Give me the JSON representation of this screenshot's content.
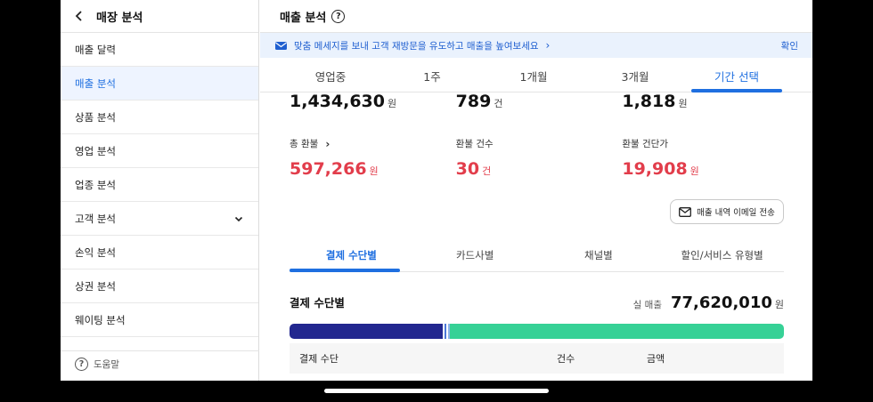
{
  "sidebar": {
    "title": "매장 분석",
    "items": [
      {
        "label": "매출 달력"
      },
      {
        "label": "매출 분석"
      },
      {
        "label": "상품 분석"
      },
      {
        "label": "영업 분석"
      },
      {
        "label": "업종 분석"
      },
      {
        "label": "고객 분석"
      },
      {
        "label": "손익 분석"
      },
      {
        "label": "상권 분석"
      },
      {
        "label": "웨이팅 분석"
      }
    ],
    "active_index": 1,
    "help_label": "도움말"
  },
  "header": {
    "title": "매출 분석"
  },
  "banner": {
    "text": "맞춤 메세지를 보내 고객 재방문을 유도하고 매출을 높여보세요",
    "confirm": "확인"
  },
  "period_tabs": [
    "영업중",
    "1주",
    "1개월",
    "3개월",
    "기간 선택"
  ],
  "period_active": "기간 선택",
  "stats_top": [
    {
      "value": "1,434,630",
      "unit": "원"
    },
    {
      "value": "789",
      "unit": "건"
    },
    {
      "value": "1,818",
      "unit": "원"
    }
  ],
  "stats_refund": [
    {
      "label": "총 환불",
      "value": "597,266",
      "unit": "원"
    },
    {
      "label": "환불 건수",
      "value": "30",
      "unit": "건"
    },
    {
      "label": "환불 건단가",
      "value": "19,908",
      "unit": "원"
    }
  ],
  "email_button": "매출 내역 이메일 전송",
  "sub_tabs": [
    "결제 수단별",
    "카드사별",
    "채널별",
    "할인/서비스 유형별"
  ],
  "sub_active": "결제 수단별",
  "section": {
    "title": "결제 수단별",
    "net_label": "실 매출",
    "net_value": "77,620,010",
    "net_unit": "원"
  },
  "distribution": [
    {
      "share": 0.31,
      "color": "#22278f"
    },
    {
      "share": 0.003,
      "color": "#ffffff"
    },
    {
      "share": 0.004,
      "color": "#4a78d8"
    },
    {
      "share": 0.003,
      "color": "#ffffff"
    },
    {
      "share": 0.004,
      "color": "#8fb3ea"
    },
    {
      "share": 0.676,
      "color": "#36d196"
    }
  ],
  "table": {
    "headers": [
      "결제 수단",
      "건수",
      "금액"
    ]
  },
  "colors": {
    "accent": "#1f6fe0",
    "refund": "#e23d4b",
    "banner_bg": "#eaf2fd"
  }
}
